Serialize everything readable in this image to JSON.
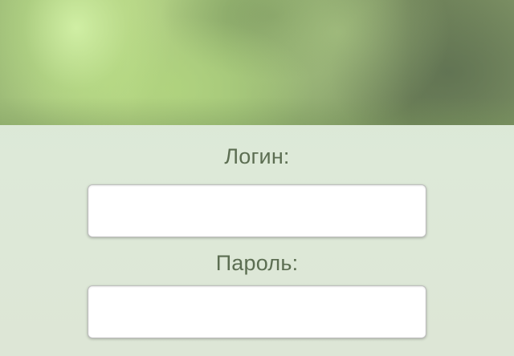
{
  "banner": {
    "type": "blurred-foliage-image"
  },
  "form": {
    "login_label": "Логин:",
    "login_value": "",
    "password_label": "Пароль:",
    "password_value": ""
  }
}
